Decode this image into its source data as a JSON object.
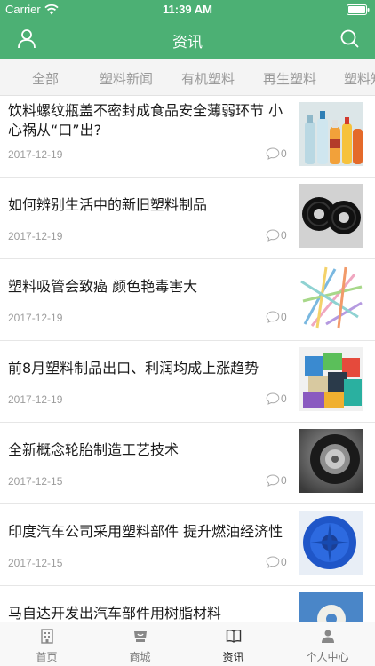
{
  "status_bar": {
    "carrier": "Carrier",
    "time": "11:39 AM"
  },
  "nav": {
    "title": "资讯",
    "left_icon": "user-icon",
    "right_icon": "search-icon"
  },
  "tabs": [
    {
      "label": "全部"
    },
    {
      "label": "塑料新闻"
    },
    {
      "label": "有机塑料"
    },
    {
      "label": "再生塑料"
    },
    {
      "label": "塑料知"
    }
  ],
  "articles": [
    {
      "title": "饮料螺纹瓶盖不密封成食品安全薄弱环节 小心祸从“口”出?",
      "date": "2017-12-19",
      "comments": "0",
      "image": "bottles-image"
    },
    {
      "title": "如何辨别生活中的新旧塑料制品",
      "date": "2017-12-19",
      "comments": "0",
      "image": "reels-image"
    },
    {
      "title": "塑料吸管会致癌 颜色艳毒害大",
      "date": "2017-12-19",
      "comments": "0",
      "image": "straws-image"
    },
    {
      "title": "前8月塑料制品出口、利润均成上涨趋势",
      "date": "2017-12-19",
      "comments": "0",
      "image": "blocks-image"
    },
    {
      "title": "全新概念轮胎制造工艺技术",
      "date": "2017-12-15",
      "comments": "0",
      "image": "tire-image"
    },
    {
      "title": "印度汽车公司采用塑料部件 提升燃油经济性",
      "date": "2017-12-15",
      "comments": "0",
      "image": "fan-image"
    },
    {
      "title": "马自达开发出汽车部件用树脂材料",
      "date": "",
      "comments": "",
      "image": "resin-part-image"
    }
  ],
  "tab_bar": [
    {
      "label": "首页",
      "icon": "building-icon"
    },
    {
      "label": "商城",
      "icon": "shop-icon"
    },
    {
      "label": "资讯",
      "icon": "book-icon"
    },
    {
      "label": "个人中心",
      "icon": "person-icon"
    }
  ],
  "colors": {
    "brand": "#4cb074",
    "tab_text": "#9a9a9a",
    "meta_text": "#9c9c9c"
  }
}
